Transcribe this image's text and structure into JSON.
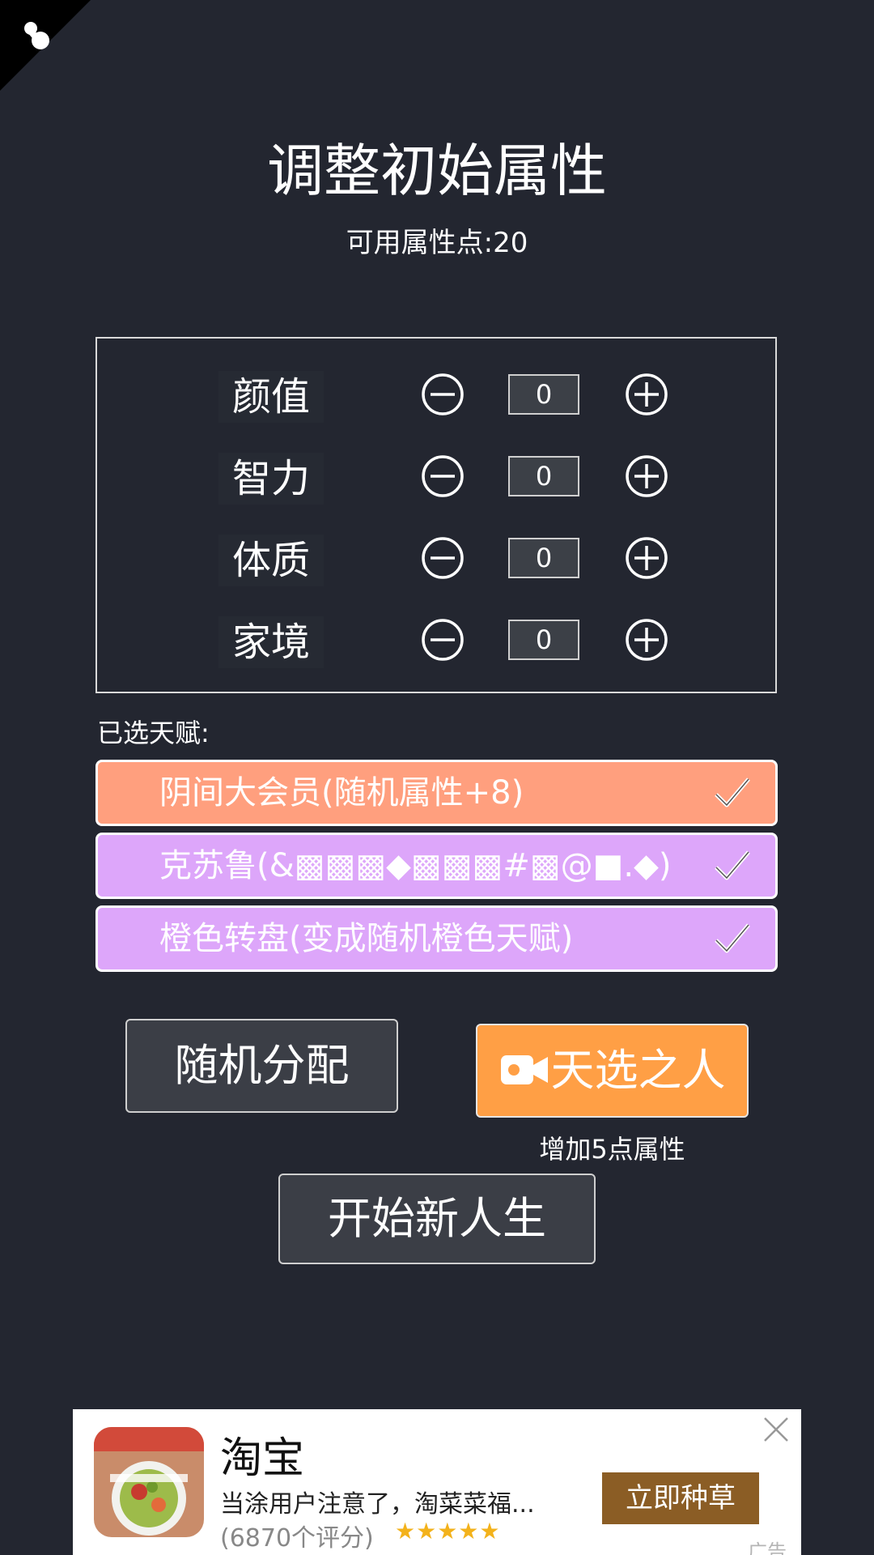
{
  "header": {
    "title": "调整初始属性",
    "points_label": "可用属性点:20"
  },
  "attributes": [
    {
      "label": "颜值",
      "value": "0"
    },
    {
      "label": "智力",
      "value": "0"
    },
    {
      "label": "体质",
      "value": "0"
    },
    {
      "label": "家境",
      "value": "0"
    }
  ],
  "talents": {
    "heading": "已选天赋:",
    "items": [
      {
        "text": "阴间大会员(随机属性+8)",
        "color": "#ff9f7e"
      },
      {
        "text": "克苏鲁(&▩▩▩◆▩▩▩#▩@■.◆)",
        "color": "#dda6fa"
      },
      {
        "text": "橙色转盘(变成随机橙色天赋)",
        "color": "#dda6fa"
      }
    ]
  },
  "actions": {
    "random_label": "随机分配",
    "chosen_label": "天选之人",
    "chosen_sub": "增加5点属性",
    "start_label": "开始新人生"
  },
  "ad": {
    "title": "淘宝",
    "desc": "当涂用户注意了，淘菜菜福...",
    "rating": "(6870个评分)",
    "stars": "★★★★★",
    "cta": "立即种草",
    "tag": "广告"
  },
  "icons": {
    "corner": "pin-icon",
    "minus": "minus-circle-icon",
    "plus": "plus-circle-icon",
    "check": "checkmark-icon",
    "video": "video-camera-icon",
    "close": "close-icon"
  },
  "colors": {
    "background": "#232630",
    "talent_orange": "#ff9f7e",
    "talent_purple": "#dda6fa",
    "chosen_button": "#ff9f45",
    "ad_cta": "#8b5d25",
    "stars": "#f3b21b"
  }
}
